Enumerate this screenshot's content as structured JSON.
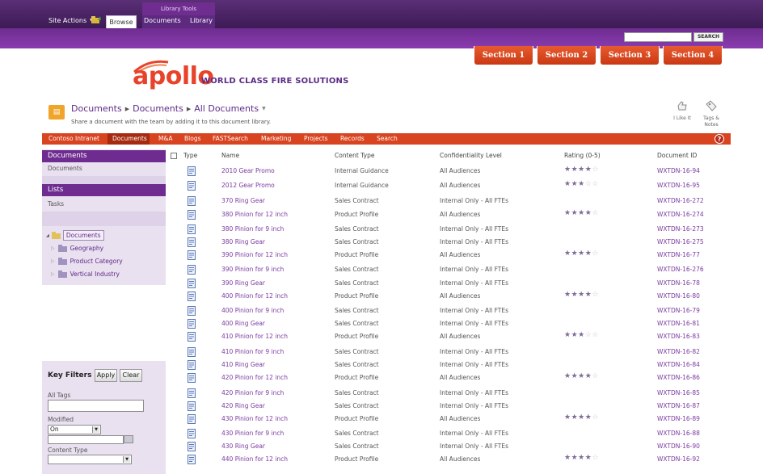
{
  "ribbon": {
    "site_actions": "Site Actions",
    "browse_tab": "Browse",
    "library_tools": "Library Tools",
    "documents_tab": "Documents",
    "library_tab": "Library"
  },
  "search": {
    "button": "SEARCH",
    "value": ""
  },
  "sections": [
    "Section 1",
    "Section 2",
    "Section 3",
    "Section 4"
  ],
  "brand": {
    "logo": "apollo",
    "tagline": "WORLD CLASS FIRE SOLUTIONS",
    "logo_color": "#e8432a",
    "brand_purple": "#6e2c90",
    "accent_red": "#d84320"
  },
  "breadcrumb": {
    "items": [
      "Documents",
      "Documents",
      "All Documents"
    ],
    "description": "Share a document with the team by adding it to this document library."
  },
  "social": {
    "like": "I Like It",
    "tags": "Tags & Notes"
  },
  "topnav": [
    "Contoso Intranet",
    "Documents",
    "M&A",
    "Blogs",
    "FASTSearch",
    "Marketing",
    "Projects",
    "Records",
    "Search"
  ],
  "quicklaunch": {
    "documents_heading": "Documents",
    "documents_item": "Documents",
    "lists_heading": "Lists",
    "lists_item": "Tasks"
  },
  "tree": {
    "root": "Documents",
    "items": [
      "Geography",
      "Product Category",
      "Vertical Industry"
    ]
  },
  "key_filters": {
    "title": "Key Filters",
    "apply": "Apply",
    "clear": "Clear",
    "all_tags_label": "All Tags",
    "all_tags_value": "",
    "modified_label": "Modified",
    "modified_value": "On",
    "date_value": "",
    "content_type_label": "Content Type",
    "content_type_value": ""
  },
  "table": {
    "headers": {
      "type": "Type",
      "name": "Name",
      "content_type": "Content Type",
      "confidentiality": "Confidentiality Level",
      "rating": "Rating (0-5)",
      "doc_id": "Document ID"
    },
    "rows": [
      {
        "name": "2010 Gear Promo",
        "content_type": "Internal Guidance",
        "confidentiality": "All Audiences",
        "rating": 4,
        "doc_id": "WXTDN-16-94"
      },
      {
        "name": "2012 Gear Promo",
        "content_type": "Internal Guidance",
        "confidentiality": "All Audiences",
        "rating": 3,
        "doc_id": "WXTDN-16-95"
      },
      {
        "name": "370 Ring Gear",
        "content_type": "Sales Contract",
        "confidentiality": "Internal Only - All FTEs",
        "rating": null,
        "doc_id": "WXTDN-16-272"
      },
      {
        "name": "380 Pinion for 12 inch",
        "content_type": "Product Profile",
        "confidentiality": "All Audiences",
        "rating": 4,
        "doc_id": "WXTDN-16-274"
      },
      {
        "name": "380 Pinion for 9 inch",
        "content_type": "Sales Contract",
        "confidentiality": "Internal Only - All FTEs",
        "rating": null,
        "doc_id": "WXTDN-16-273"
      },
      {
        "name": "380 Ring Gear",
        "content_type": "Sales Contract",
        "confidentiality": "Internal Only - All FTEs",
        "rating": null,
        "doc_id": "WXTDN-16-275"
      },
      {
        "name": "390 Pinion for 12 inch",
        "content_type": "Product Profile",
        "confidentiality": "All Audiences",
        "rating": 4,
        "doc_id": "WXTDN-16-77"
      },
      {
        "name": "390 Pinion for 9 inch",
        "content_type": "Sales Contract",
        "confidentiality": "Internal Only - All FTEs",
        "rating": null,
        "doc_id": "WXTDN-16-276"
      },
      {
        "name": "390 Ring Gear",
        "content_type": "Sales Contract",
        "confidentiality": "Internal Only - All FTEs",
        "rating": null,
        "doc_id": "WXTDN-16-78"
      },
      {
        "name": "400 Pinion for 12 inch",
        "content_type": "Product Profile",
        "confidentiality": "All Audiences",
        "rating": 4,
        "doc_id": "WXTDN-16-80"
      },
      {
        "name": "400 Pinion for 9 inch",
        "content_type": "Sales Contract",
        "confidentiality": "Internal Only - All FTEs",
        "rating": null,
        "doc_id": "WXTDN-16-79"
      },
      {
        "name": "400 Ring Gear",
        "content_type": "Sales Contract",
        "confidentiality": "Internal Only - All FTEs",
        "rating": null,
        "doc_id": "WXTDN-16-81"
      },
      {
        "name": "410 Pinion for 12 inch",
        "content_type": "Product Profile",
        "confidentiality": "All Audiences",
        "rating": 3,
        "doc_id": "WXTDN-16-83"
      },
      {
        "name": "410 Pinion for 9 inch",
        "content_type": "Sales Contract",
        "confidentiality": "Internal Only - All FTEs",
        "rating": null,
        "doc_id": "WXTDN-16-82"
      },
      {
        "name": "410 Ring Gear",
        "content_type": "Sales Contract",
        "confidentiality": "Internal Only - All FTEs",
        "rating": null,
        "doc_id": "WXTDN-16-84"
      },
      {
        "name": "420 Pinion for 12 inch",
        "content_type": "Product Profile",
        "confidentiality": "All Audiences",
        "rating": 4,
        "doc_id": "WXTDN-16-86"
      },
      {
        "name": "420 Pinion for 9 inch",
        "content_type": "Sales Contract",
        "confidentiality": "Internal Only - All FTEs",
        "rating": null,
        "doc_id": "WXTDN-16-85"
      },
      {
        "name": "420 Ring Gear",
        "content_type": "Sales Contract",
        "confidentiality": "Internal Only - All FTEs",
        "rating": null,
        "doc_id": "WXTDN-16-87"
      },
      {
        "name": "430 Pinion for 12 inch",
        "content_type": "Product Profile",
        "confidentiality": "All Audiences",
        "rating": 4,
        "doc_id": "WXTDN-16-89"
      },
      {
        "name": "430 Pinion for 9 inch",
        "content_type": "Sales Contract",
        "confidentiality": "Internal Only - All FTEs",
        "rating": null,
        "doc_id": "WXTDN-16-88"
      },
      {
        "name": "430 Ring Gear",
        "content_type": "Sales Contract",
        "confidentiality": "Internal Only - All FTEs",
        "rating": null,
        "doc_id": "WXTDN-16-90"
      },
      {
        "name": "440 Pinion for 12 inch",
        "content_type": "Product Profile",
        "confidentiality": "All Audiences",
        "rating": 4,
        "doc_id": "WXTDN-16-92"
      }
    ]
  }
}
